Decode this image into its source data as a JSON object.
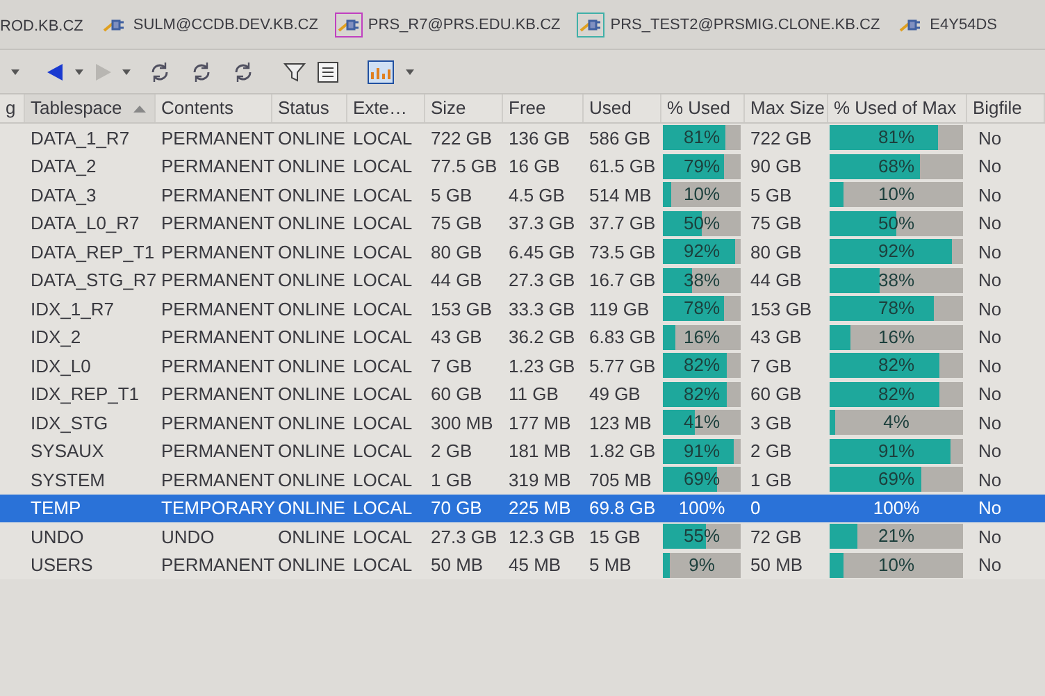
{
  "connection_tabs": [
    {
      "label": "ROD.KB.CZ"
    },
    {
      "label": "SULM@CCDB.DEV.KB.CZ",
      "framed": false
    },
    {
      "label": "PRS_R7@PRS.EDU.KB.CZ",
      "framed": true,
      "color": "#c040c0"
    },
    {
      "label": "PRS_TEST2@PRSMIG.CLONE.KB.CZ",
      "framed": true,
      "color": "#40b0a8"
    },
    {
      "label": "E4Y54DS",
      "framed": false
    }
  ],
  "table": {
    "columns": [
      {
        "label": "g",
        "sorted": false
      },
      {
        "label": "Tablespace",
        "sorted": true
      },
      {
        "label": "Contents",
        "sorted": false
      },
      {
        "label": "Status",
        "sorted": false
      },
      {
        "label": "Exte…",
        "sorted": false
      },
      {
        "label": "Size",
        "sorted": false
      },
      {
        "label": "Free",
        "sorted": false
      },
      {
        "label": "Used",
        "sorted": false
      },
      {
        "label": "% Used",
        "sorted": false
      },
      {
        "label": "Max Size",
        "sorted": false
      },
      {
        "label": "% Used of Max",
        "sorted": false
      },
      {
        "label": "Bigfile",
        "sorted": false
      }
    ],
    "rows": [
      {
        "tablespace": "DATA_1_R7",
        "contents": "PERMANENT",
        "status": "ONLINE",
        "extent": "LOCAL",
        "size": "722 GB",
        "free": "136 GB",
        "used": "586 GB",
        "pct_used": {
          "label": "81%",
          "level": 0.81
        },
        "max_size": "722 GB",
        "pct_used_of_max": {
          "label": "81%",
          "level": 0.81
        },
        "bigfile": "No",
        "selected": false
      },
      {
        "tablespace": "DATA_2",
        "contents": "PERMANENT",
        "status": "ONLINE",
        "extent": "LOCAL",
        "size": "77.5 GB",
        "free": "16 GB",
        "used": "61.5 GB",
        "pct_used": {
          "label": "79%",
          "level": 0.79
        },
        "max_size": "90 GB",
        "pct_used_of_max": {
          "label": "68%",
          "level": 0.68
        },
        "bigfile": "No",
        "selected": false
      },
      {
        "tablespace": "DATA_3",
        "contents": "PERMANENT",
        "status": "ONLINE",
        "extent": "LOCAL",
        "size": "5 GB",
        "free": "4.5 GB",
        "used": "514 MB",
        "pct_used": {
          "label": "10%",
          "level": 0.1
        },
        "max_size": "5 GB",
        "pct_used_of_max": {
          "label": "10%",
          "level": 0.1
        },
        "bigfile": "No",
        "selected": false
      },
      {
        "tablespace": "DATA_L0_R7",
        "contents": "PERMANENT",
        "status": "ONLINE",
        "extent": "LOCAL",
        "size": "75 GB",
        "free": "37.3 GB",
        "used": "37.7 GB",
        "pct_used": {
          "label": "50%",
          "level": 0.5
        },
        "max_size": "75 GB",
        "pct_used_of_max": {
          "label": "50%",
          "level": 0.5
        },
        "bigfile": "No",
        "selected": false
      },
      {
        "tablespace": "DATA_REP_T1",
        "contents": "PERMANENT",
        "status": "ONLINE",
        "extent": "LOCAL",
        "size": "80 GB",
        "free": "6.45 GB",
        "used": "73.5 GB",
        "pct_used": {
          "label": "92%",
          "level": 0.92
        },
        "max_size": "80 GB",
        "pct_used_of_max": {
          "label": "92%",
          "level": 0.92
        },
        "bigfile": "No",
        "selected": false
      },
      {
        "tablespace": "DATA_STG_R7",
        "contents": "PERMANENT",
        "status": "ONLINE",
        "extent": "LOCAL",
        "size": "44 GB",
        "free": "27.3 GB",
        "used": "16.7 GB",
        "pct_used": {
          "label": "38%",
          "level": 0.38
        },
        "max_size": "44 GB",
        "pct_used_of_max": {
          "label": "38%",
          "level": 0.38
        },
        "bigfile": "No",
        "selected": false
      },
      {
        "tablespace": "IDX_1_R7",
        "contents": "PERMANENT",
        "status": "ONLINE",
        "extent": "LOCAL",
        "size": "153 GB",
        "free": "33.3 GB",
        "used": "119 GB",
        "pct_used": {
          "label": "78%",
          "level": 0.78
        },
        "max_size": "153 GB",
        "pct_used_of_max": {
          "label": "78%",
          "level": 0.78
        },
        "bigfile": "No",
        "selected": false
      },
      {
        "tablespace": "IDX_2",
        "contents": "PERMANENT",
        "status": "ONLINE",
        "extent": "LOCAL",
        "size": "43 GB",
        "free": "36.2 GB",
        "used": "6.83 GB",
        "pct_used": {
          "label": "16%",
          "level": 0.16
        },
        "max_size": "43 GB",
        "pct_used_of_max": {
          "label": "16%",
          "level": 0.16
        },
        "bigfile": "No",
        "selected": false
      },
      {
        "tablespace": "IDX_L0",
        "contents": "PERMANENT",
        "status": "ONLINE",
        "extent": "LOCAL",
        "size": "7 GB",
        "free": "1.23 GB",
        "used": "5.77 GB",
        "pct_used": {
          "label": "82%",
          "level": 0.82
        },
        "max_size": "7 GB",
        "pct_used_of_max": {
          "label": "82%",
          "level": 0.82
        },
        "bigfile": "No",
        "selected": false
      },
      {
        "tablespace": "IDX_REP_T1",
        "contents": "PERMANENT",
        "status": "ONLINE",
        "extent": "LOCAL",
        "size": "60 GB",
        "free": "11 GB",
        "used": "49 GB",
        "pct_used": {
          "label": "82%",
          "level": 0.82
        },
        "max_size": "60 GB",
        "pct_used_of_max": {
          "label": "82%",
          "level": 0.82
        },
        "bigfile": "No",
        "selected": false
      },
      {
        "tablespace": "IDX_STG",
        "contents": "PERMANENT",
        "status": "ONLINE",
        "extent": "LOCAL",
        "size": "300 MB",
        "free": "177 MB",
        "used": "123 MB",
        "pct_used": {
          "label": "41%",
          "level": 0.41
        },
        "max_size": "3 GB",
        "pct_used_of_max": {
          "label": "4%",
          "level": 0.04
        },
        "bigfile": "No",
        "selected": false
      },
      {
        "tablespace": "SYSAUX",
        "contents": "PERMANENT",
        "status": "ONLINE",
        "extent": "LOCAL",
        "size": "2 GB",
        "free": "181 MB",
        "used": "1.82 GB",
        "pct_used": {
          "label": "91%",
          "level": 0.91
        },
        "max_size": "2 GB",
        "pct_used_of_max": {
          "label": "91%",
          "level": 0.91
        },
        "bigfile": "No",
        "selected": false
      },
      {
        "tablespace": "SYSTEM",
        "contents": "PERMANENT",
        "status": "ONLINE",
        "extent": "LOCAL",
        "size": "1 GB",
        "free": "319 MB",
        "used": "705 MB",
        "pct_used": {
          "label": "69%",
          "level": 0.69
        },
        "max_size": "1 GB",
        "pct_used_of_max": {
          "label": "69%",
          "level": 0.69
        },
        "bigfile": "No",
        "selected": false
      },
      {
        "tablespace": "TEMP",
        "contents": "TEMPORARY",
        "status": "ONLINE",
        "extent": "LOCAL",
        "size": "70 GB",
        "free": "225 MB",
        "used": "69.8 GB",
        "pct_used": {
          "label": "100%"
        },
        "max_size": "0",
        "pct_used_of_max": {
          "label": "100%"
        },
        "bigfile": "No",
        "selected": true
      },
      {
        "tablespace": "UNDO",
        "contents": "UNDO",
        "status": "ONLINE",
        "extent": "LOCAL",
        "size": "27.3 GB",
        "free": "12.3 GB",
        "used": "15 GB",
        "pct_used": {
          "label": "55%",
          "level": 0.55
        },
        "max_size": "72 GB",
        "pct_used_of_max": {
          "label": "21%",
          "level": 0.21
        },
        "bigfile": "No",
        "selected": false
      },
      {
        "tablespace": "USERS",
        "contents": "PERMANENT",
        "status": "ONLINE",
        "extent": "LOCAL",
        "size": "50 MB",
        "free": "45 MB",
        "used": "5 MB",
        "pct_used": {
          "label": "9%",
          "level": 0.09
        },
        "max_size": "50 MB",
        "pct_used_of_max": {
          "label": "10%",
          "level": 0.1
        },
        "bigfile": "No",
        "selected": false
      }
    ]
  }
}
